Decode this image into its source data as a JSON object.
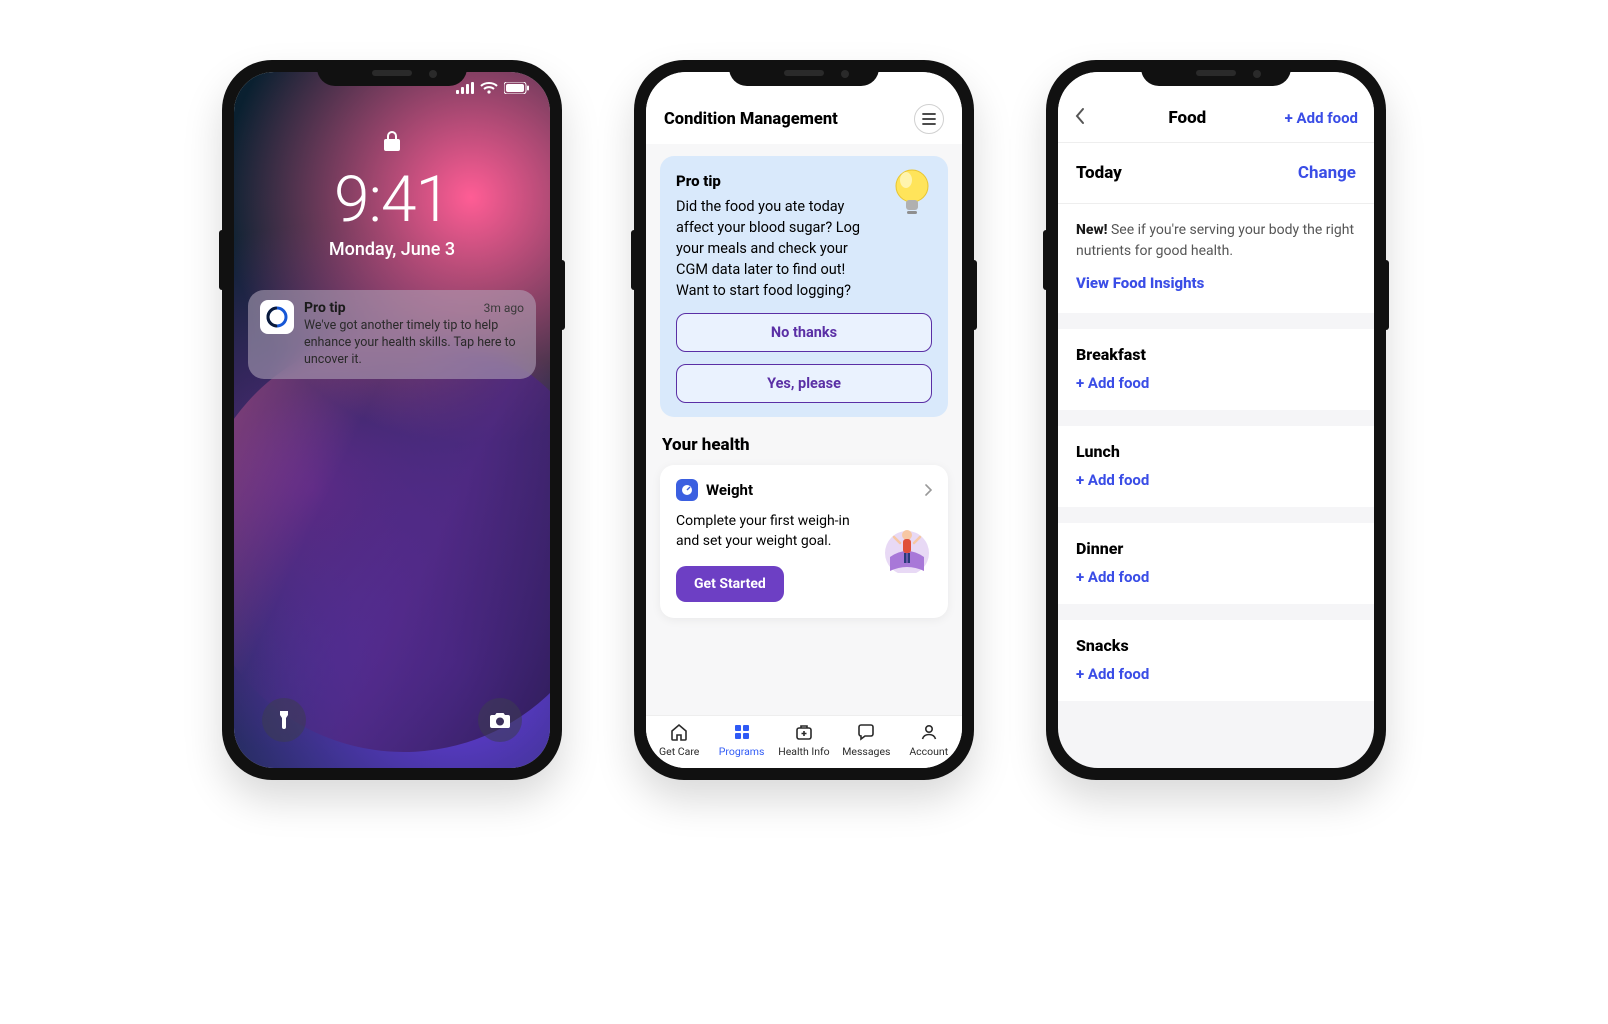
{
  "phone1": {
    "time": "9:41",
    "date": "Monday, June 3",
    "notification": {
      "title": "Pro tip",
      "timeago": "3m ago",
      "body": "We've got another timely tip to help enhance your health skills. Tap here to uncover it."
    }
  },
  "phone2": {
    "header_title": "Condition Management",
    "protip": {
      "title": "Pro tip",
      "body": "Did the food you ate today affect your blood sugar? Log your meals and check your CGM data later to find out! Want to start food logging?",
      "no_label": "No thanks",
      "yes_label": "Yes, please"
    },
    "your_health_title": "Your health",
    "weight_card": {
      "label": "Weight",
      "body": "Complete your first weigh-in and set your weight goal.",
      "cta": "Get Started"
    },
    "tabs": [
      {
        "label": "Get Care"
      },
      {
        "label": "Programs"
      },
      {
        "label": "Health Info"
      },
      {
        "label": "Messages"
      },
      {
        "label": "Account"
      }
    ]
  },
  "phone3": {
    "title": "Food",
    "add_top": "+ Add food",
    "today": "Today",
    "change": "Change",
    "banner_bold": "New!",
    "banner_rest": " See if you're serving your body the right nutrients for good health.",
    "link": "View Food Insights",
    "meals": [
      {
        "name": "Breakfast",
        "add": "+ Add food"
      },
      {
        "name": "Lunch",
        "add": "+ Add food"
      },
      {
        "name": "Dinner",
        "add": "+ Add food"
      },
      {
        "name": "Snacks",
        "add": "+ Add food"
      }
    ]
  }
}
